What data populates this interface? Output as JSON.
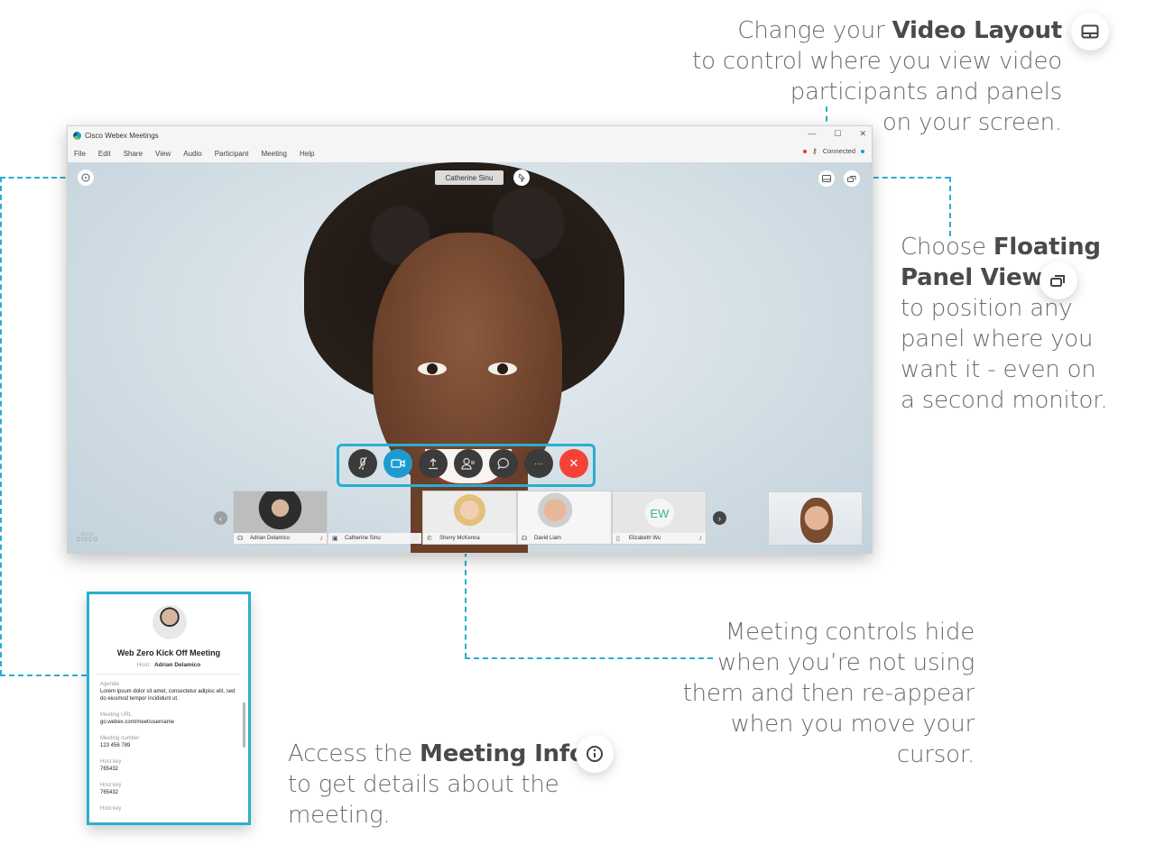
{
  "window": {
    "app_title": "Cisco Webex Meetings",
    "menu": [
      "File",
      "Edit",
      "Share",
      "View",
      "Audio",
      "Participant",
      "Meeting",
      "Help"
    ],
    "window_controls": [
      "minimize-icon",
      "maximize-icon",
      "close-icon"
    ],
    "status": {
      "label": "Connected",
      "recording_indicator": true,
      "colors": {
        "recording": "#e53935",
        "connected": "#1d9bd1"
      }
    }
  },
  "stage": {
    "active_speaker": "Catherine Sinu",
    "overlay_buttons": [
      "info-icon",
      "pin-icon",
      "video-layout-icon",
      "floating-panel-icon"
    ],
    "controls": [
      {
        "name": "mute",
        "icon": "microphone-muted-icon"
      },
      {
        "name": "video",
        "icon": "video-camera-icon"
      },
      {
        "name": "share",
        "icon": "share-upload-icon"
      },
      {
        "name": "participants",
        "icon": "participants-icon"
      },
      {
        "name": "chat",
        "icon": "chat-bubble-icon"
      },
      {
        "name": "more",
        "icon": "more-icon",
        "label": "···"
      },
      {
        "name": "end",
        "icon": "close-icon",
        "label": "✕"
      }
    ],
    "participants": [
      {
        "name": "Adrian Delamico",
        "device": "headset-icon",
        "muted": true
      },
      {
        "name": "Catherine Sinu",
        "device": "video-system-icon",
        "muted": false
      },
      {
        "name": "Sherry McKenna",
        "device": "phone-icon",
        "muted": false
      },
      {
        "name": "David Liam",
        "device": "headset-icon",
        "muted": false
      },
      {
        "name": "Elizabeth Wu",
        "device": "mobile-icon",
        "muted": true,
        "initials": "EW"
      }
    ],
    "brand": "CISCO",
    "accent_color": "#2aaed0"
  },
  "meeting_info": {
    "title": "Web Zero Kick Off Meeting",
    "host_label": "Host:",
    "host_name": "Adrian Delamico",
    "fields": [
      {
        "label": "Agenda",
        "value": "Lorem ipsum dolor sit amet, consectetur adipisc elit, sed do eiusmod tempor incididunt ut."
      },
      {
        "label": "Meeting URL",
        "value": "go.webex.com/meet/username"
      },
      {
        "label": "Meeting number",
        "value": "123 456 789"
      },
      {
        "label": "Host key",
        "value": "765432"
      },
      {
        "label": "Host key",
        "value": "765432"
      },
      {
        "label": "Host key",
        "value": ""
      }
    ]
  },
  "callouts": {
    "video_layout": {
      "pre": "Change your ",
      "bold": "Video Layout",
      "rest": [
        "to control where you view video",
        "participants and panels",
        "on your screen."
      ]
    },
    "floating_panel": {
      "pre": "Choose ",
      "bold1": "Floating",
      "bold2": "Panel View",
      "rest": [
        "to position any",
        "panel where you",
        "want it - even on",
        "a second monitor."
      ]
    },
    "meeting_controls": {
      "lines": [
        "Meeting controls hide",
        "when you’re not using",
        "them and then re-appear",
        "when you move your",
        "cursor."
      ]
    },
    "meeting_info": {
      "pre": "Access the ",
      "bold": "Meeting Info",
      "rest": [
        "to get details about the",
        "meeting."
      ]
    }
  }
}
